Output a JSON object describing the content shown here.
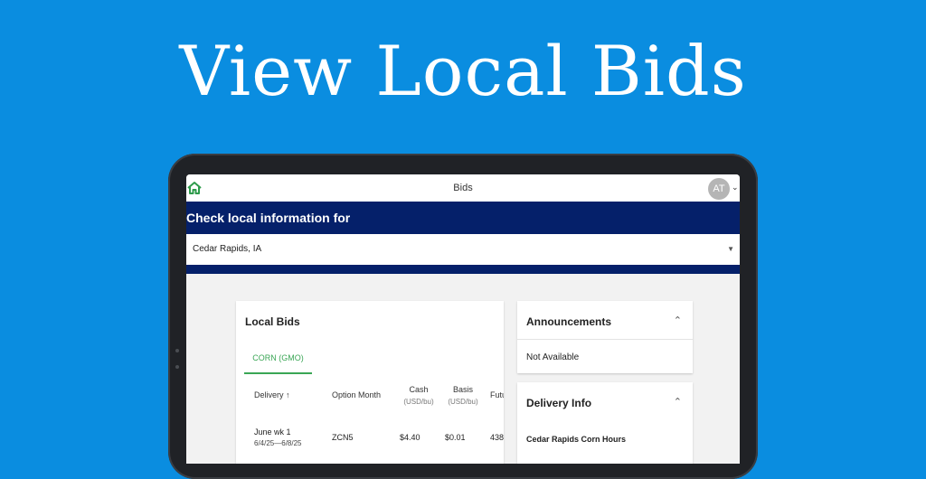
{
  "headline": "View Local Bids",
  "app": {
    "page_title": "Bids",
    "user_initials": "AT"
  },
  "location": {
    "prompt": "Check local information for",
    "selected": "Cedar Rapids, IA"
  },
  "local_bids": {
    "title": "Local Bids",
    "tabs": [
      {
        "label": "CORN (GMO)",
        "active": true
      }
    ],
    "columns": {
      "delivery": "Delivery",
      "option_month": "Option Month",
      "cash": "Cash",
      "cash_unit": "(USD/bu)",
      "basis": "Basis",
      "basis_unit": "(USD/bu)",
      "futures": "Futu"
    },
    "rows": [
      {
        "delivery": "June wk 1",
        "delivery_range": "6/4/25—6/8/25",
        "option_month": "ZCN5",
        "cash": "$4.40",
        "basis": "$0.01",
        "futures": "438"
      }
    ]
  },
  "announcements": {
    "title": "Announcements",
    "value": "Not Available"
  },
  "delivery_info": {
    "title": "Delivery Info",
    "subtitle": "Cedar Rapids Corn Hours"
  },
  "colors": {
    "background": "#0a8de0",
    "banner": "#05206a",
    "accent_green": "#3aa655"
  }
}
